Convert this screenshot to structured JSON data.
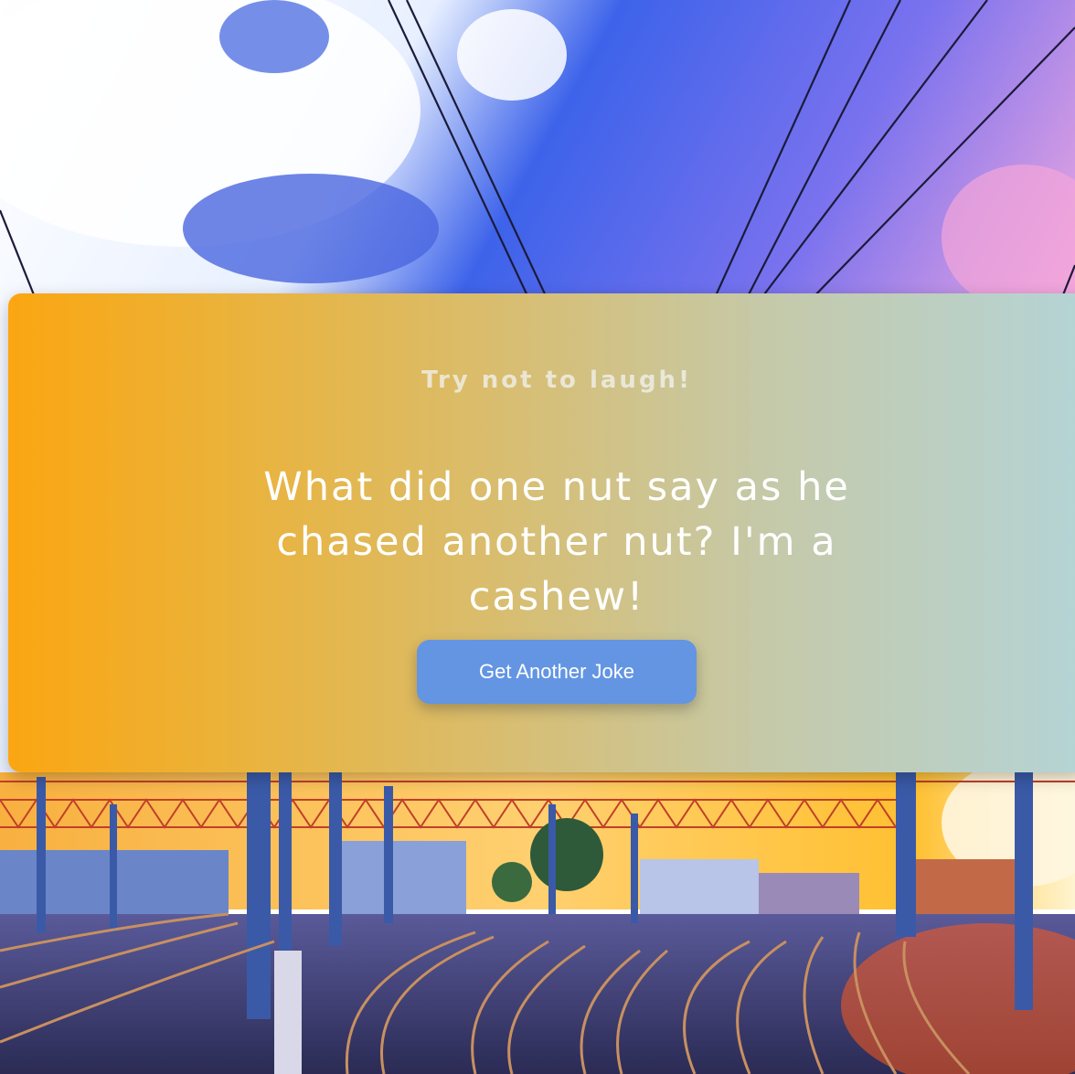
{
  "card": {
    "subtitle": "Try not to laugh!",
    "joke": "What did one nut say as he chased another nut? I'm a cashew!",
    "button_label": "Get Another Joke"
  },
  "background": {
    "image_subject": "railway-yard-at-sunset-photo",
    "sky_colors": [
      "#3b5fe0",
      "#ffffff",
      "#e9a9e3"
    ],
    "ground_colors": [
      "#f6a21a",
      "#3a2a6a",
      "#ff5a1a"
    ]
  },
  "colors": {
    "card_gradient_start": "#fba611",
    "card_gradient_end": "#b4d4d6",
    "button": "#6395e3"
  }
}
